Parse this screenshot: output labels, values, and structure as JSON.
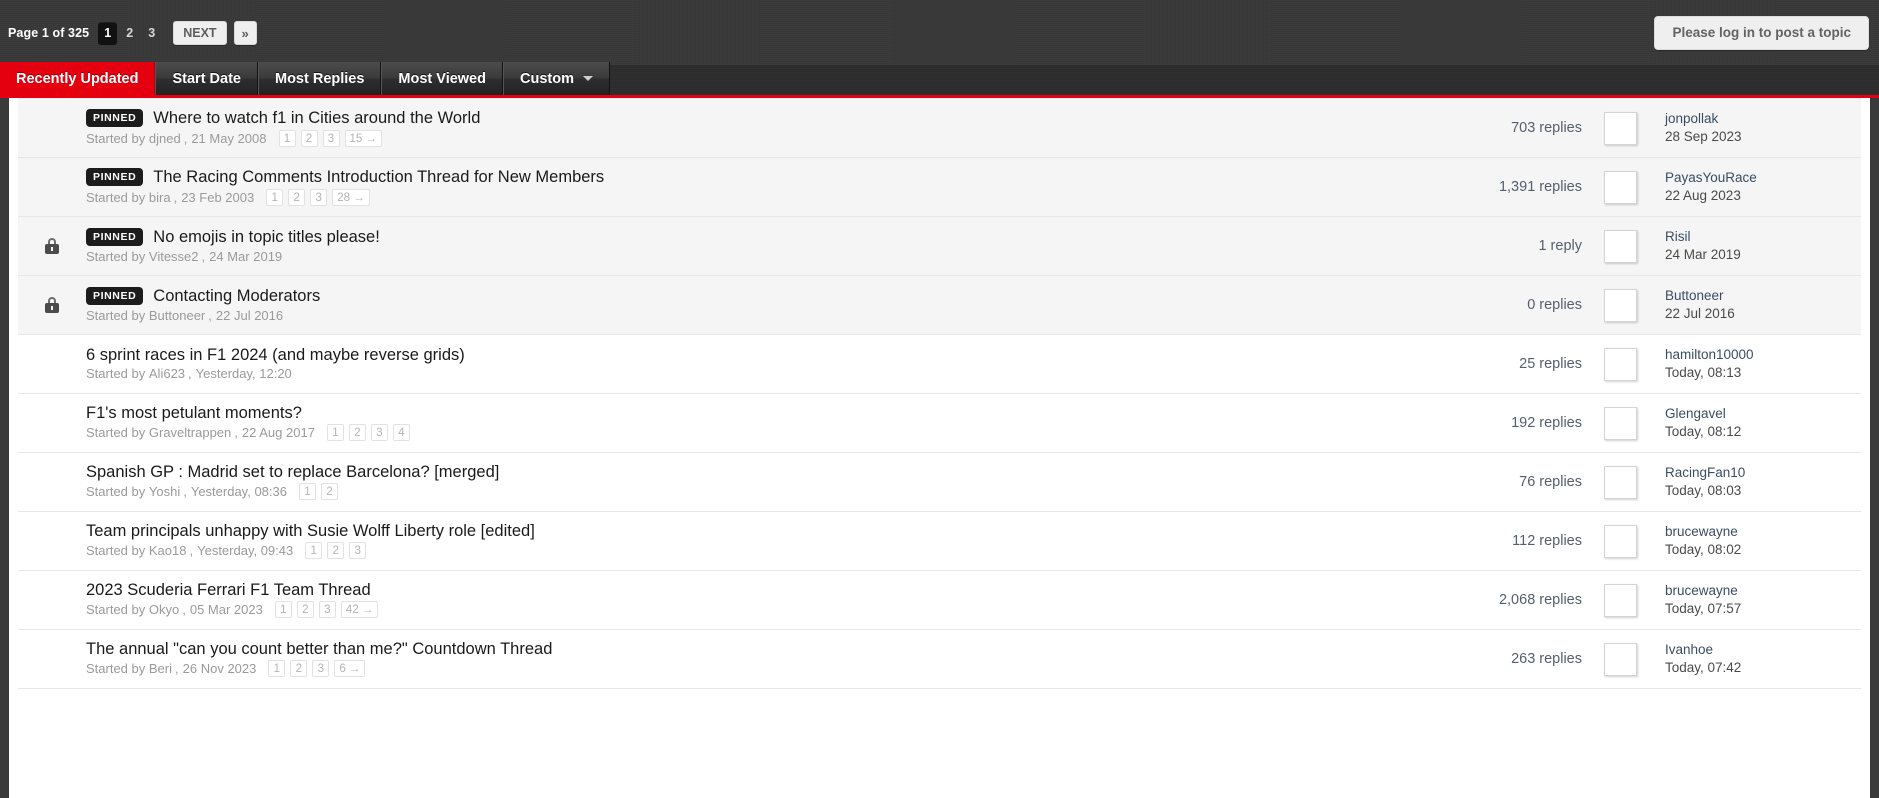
{
  "pager": {
    "page_label_prefix": "Page",
    "page_label": "Page 1 of 325",
    "pages": [
      "1",
      "2",
      "3"
    ],
    "next_label": "NEXT",
    "last_label": "»"
  },
  "header": {
    "login_button": "Please log in to post a topic"
  },
  "tabs": [
    {
      "label": "Recently Updated",
      "active": true,
      "caret": false
    },
    {
      "label": "Start Date",
      "active": false,
      "caret": false
    },
    {
      "label": "Most Replies",
      "active": false,
      "caret": false
    },
    {
      "label": "Most Viewed",
      "active": false,
      "caret": false
    },
    {
      "label": "Custom",
      "active": false,
      "caret": true
    }
  ],
  "labels": {
    "started_by": "Started by",
    "pinned": "PINNED",
    "comma": ","
  },
  "colors": {
    "accent_red": "#e4000f",
    "topbar": "#383838",
    "pinned_row": "#f5f5f5",
    "link": "#3b4d63"
  },
  "topics": [
    {
      "locked": false,
      "pinned": true,
      "title": "Where to watch f1 in Cities around the World",
      "author": "djned",
      "date": "21 May 2008",
      "pages": [
        "1",
        "2",
        "3",
        "15 →"
      ],
      "replies": "703 replies",
      "last_user": "jonpollak",
      "last_date": "28 Sep 2023",
      "avatar": "photo-woman-outdoors"
    },
    {
      "locked": false,
      "pinned": true,
      "title": "The Racing Comments Introduction Thread for New Members",
      "author": "bira",
      "date": "23 Feb 2003",
      "pages": [
        "1",
        "2",
        "3",
        "28 →"
      ],
      "replies": "1,391 replies",
      "last_user": "PayasYouRace",
      "last_date": "22 Aug 2023",
      "avatar": "cartoon-character"
    },
    {
      "locked": true,
      "pinned": true,
      "title": "No emojis in topic titles please!",
      "author": "Vitesse2",
      "date": "24 Mar 2019",
      "pages": [],
      "replies": "1 reply",
      "last_user": "Risil",
      "last_date": "24 Mar 2019",
      "avatar": "bird-in-scarf"
    },
    {
      "locked": true,
      "pinned": true,
      "title": "Contacting Moderators",
      "author": "Buttoneer",
      "date": "22 Jul 2016",
      "pages": [],
      "replies": "0 replies",
      "last_user": "Buttoneer",
      "last_date": "22 Jul 2016",
      "avatar": "man-shouting"
    },
    {
      "locked": false,
      "pinned": false,
      "title": "6 sprint races in F1 2024 (and maybe reverse grids)",
      "author": "Ali623",
      "date": "Yesterday, 12:20",
      "pages": [],
      "replies": "25 replies",
      "last_user": "hamilton10000",
      "last_date": "Today, 08:13",
      "avatar": "racing-helmet"
    },
    {
      "locked": false,
      "pinned": false,
      "title": "F1's most petulant moments?",
      "author": "Graveltrappen",
      "date": "22 Aug 2017",
      "pages": [
        "1",
        "2",
        "3",
        "4"
      ],
      "replies": "192 replies",
      "last_user": "Glengavel",
      "last_date": "Today, 08:12",
      "avatar": "alfa-romeo-badge"
    },
    {
      "locked": false,
      "pinned": false,
      "title": "Spanish GP : Madrid set to replace Barcelona? [merged]",
      "author": "Yoshi",
      "date": "Yesterday, 08:36",
      "pages": [
        "1",
        "2"
      ],
      "replies": "76 replies",
      "last_user": "RacingFan10",
      "last_date": "Today, 08:03",
      "avatar": "ferrari-driver"
    },
    {
      "locked": false,
      "pinned": false,
      "title": "Team principals unhappy with Susie Wolff Liberty role [edited]",
      "author": "Kao18",
      "date": "Yesterday, 09:43",
      "pages": [
        "1",
        "2",
        "3"
      ],
      "replies": "112 replies",
      "last_user": "brucewayne",
      "last_date": "Today, 08:02",
      "avatar": "ferrari-car-red"
    },
    {
      "locked": false,
      "pinned": false,
      "title": "2023 Scuderia Ferrari F1 Team Thread",
      "author": "Okyo",
      "date": "05 Mar 2023",
      "pages": [
        "1",
        "2",
        "3",
        "42 →"
      ],
      "replies": "2,068 replies",
      "last_user": "brucewayne",
      "last_date": "Today, 07:57",
      "avatar": "ferrari-car-red"
    },
    {
      "locked": false,
      "pinned": false,
      "title": "The annual \"can you count better than me?\" Countdown Thread",
      "author": "Beri",
      "date": "26 Nov 2023",
      "pages": [
        "1",
        "2",
        "3",
        "6 →"
      ],
      "replies": "263 replies",
      "last_user": "Ivanhoe",
      "last_date": "Today, 07:42",
      "avatar": "dark-portrait"
    }
  ]
}
